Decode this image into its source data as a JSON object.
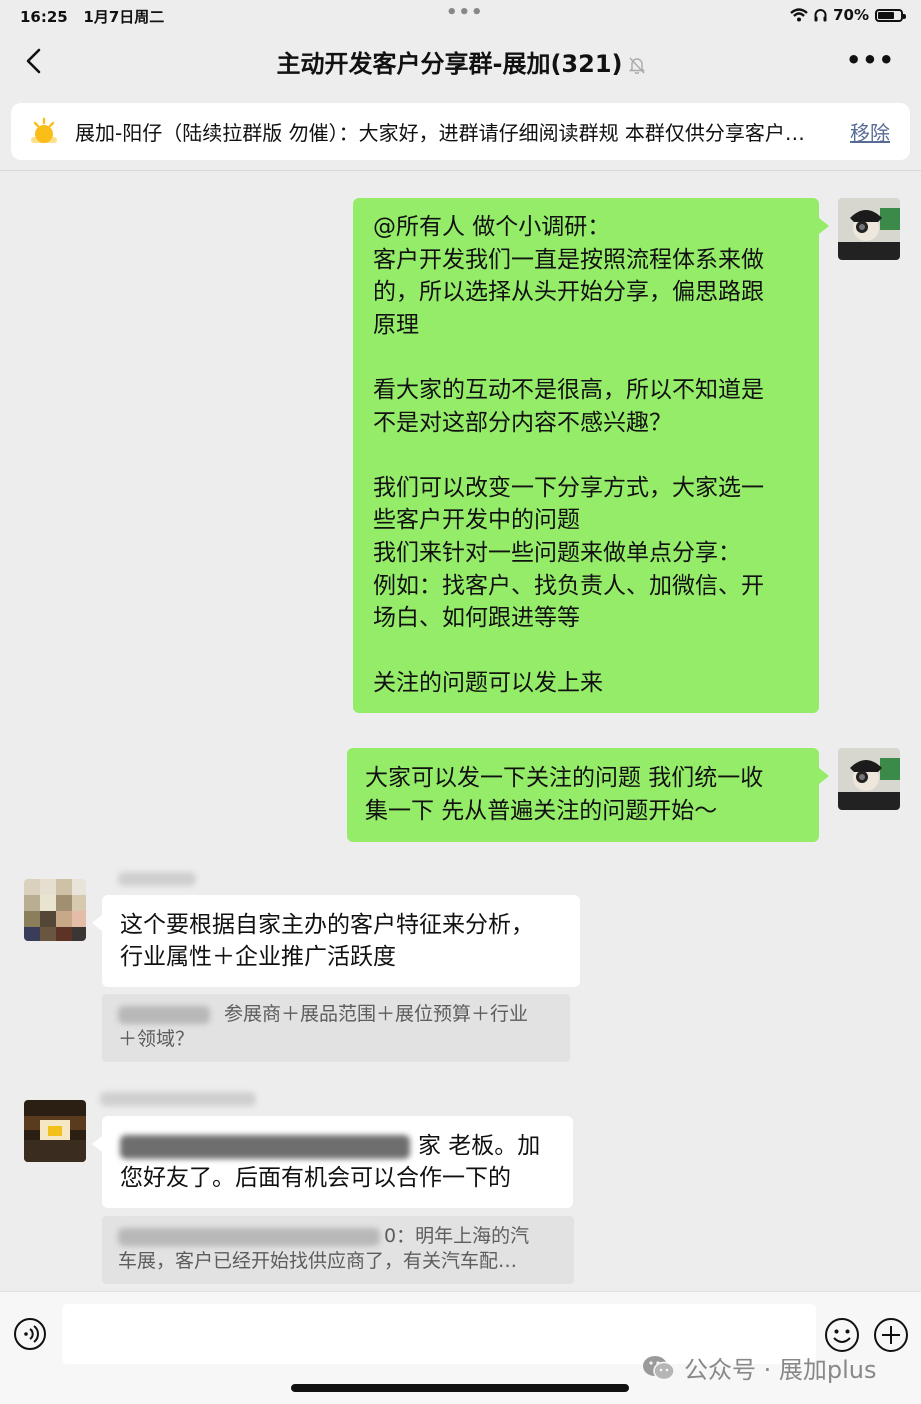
{
  "status_bar": {
    "time": "16:25",
    "date": "1月7日周二",
    "battery": "70%"
  },
  "header": {
    "title": "主动开发客户分享群-展加(321)"
  },
  "notice": {
    "text": "展加-阳仔（陆续拉群版 勿催）：大家好，进群请仔细阅读群规 本群仅供分享客户…",
    "remove_label": "移除"
  },
  "messages": {
    "msg1": {
      "line1": "@所有人 做个小调研：",
      "line2": "客户开发我们一直是按照流程体系来做",
      "line3": "的，所以选择从头开始分享，偏思路跟",
      "line4": "原理",
      "line5": "看大家的互动不是很高，所以不知道是",
      "line6": "不是对这部分内容不感兴趣？",
      "line7": "我们可以改变一下分享方式，大家选一",
      "line8": "些客户开发中的问题",
      "line9": "我们来针对一些问题来做单点分享：",
      "line10": "例如：找客户、找负责人、加微信、开",
      "line11": "场白、如何跟进等等",
      "line12": "关注的问题可以发上来"
    },
    "msg2": {
      "line1": "大家可以发一下关注的问题 我们统一收",
      "line2": "集一下 先从普遍关注的问题开始～"
    },
    "msg3": {
      "line1": "这个要根据自家主办的客户特征来分析，",
      "line2": "行业属性＋企业推广活跃度",
      "quote_line1": "参展商＋展品范围＋展位预算＋行业",
      "quote_line2": "＋领域？"
    },
    "msg4": {
      "line1_end": "家 老板。加",
      "line2": "您好友了。后面有机会可以合作一下的",
      "quote_line1_end": "0：明年上海的汽",
      "quote_line2": "车展，客户已经开始找供应商了，有关汽车配…"
    }
  },
  "watermark": {
    "text": "公众号 · 展加plus"
  },
  "colors": {
    "self_bubble": "#95ec69",
    "other_bubble": "#ffffff",
    "chat_background": "#ededed",
    "link": "#576b95"
  },
  "icons": [
    "back-icon",
    "mute-bell-icon",
    "more-icon",
    "notice-bulb-icon",
    "voice-icon",
    "emoji-icon",
    "plus-icon",
    "wechat-icon",
    "wifi-icon",
    "headphones-icon",
    "battery-icon"
  ]
}
